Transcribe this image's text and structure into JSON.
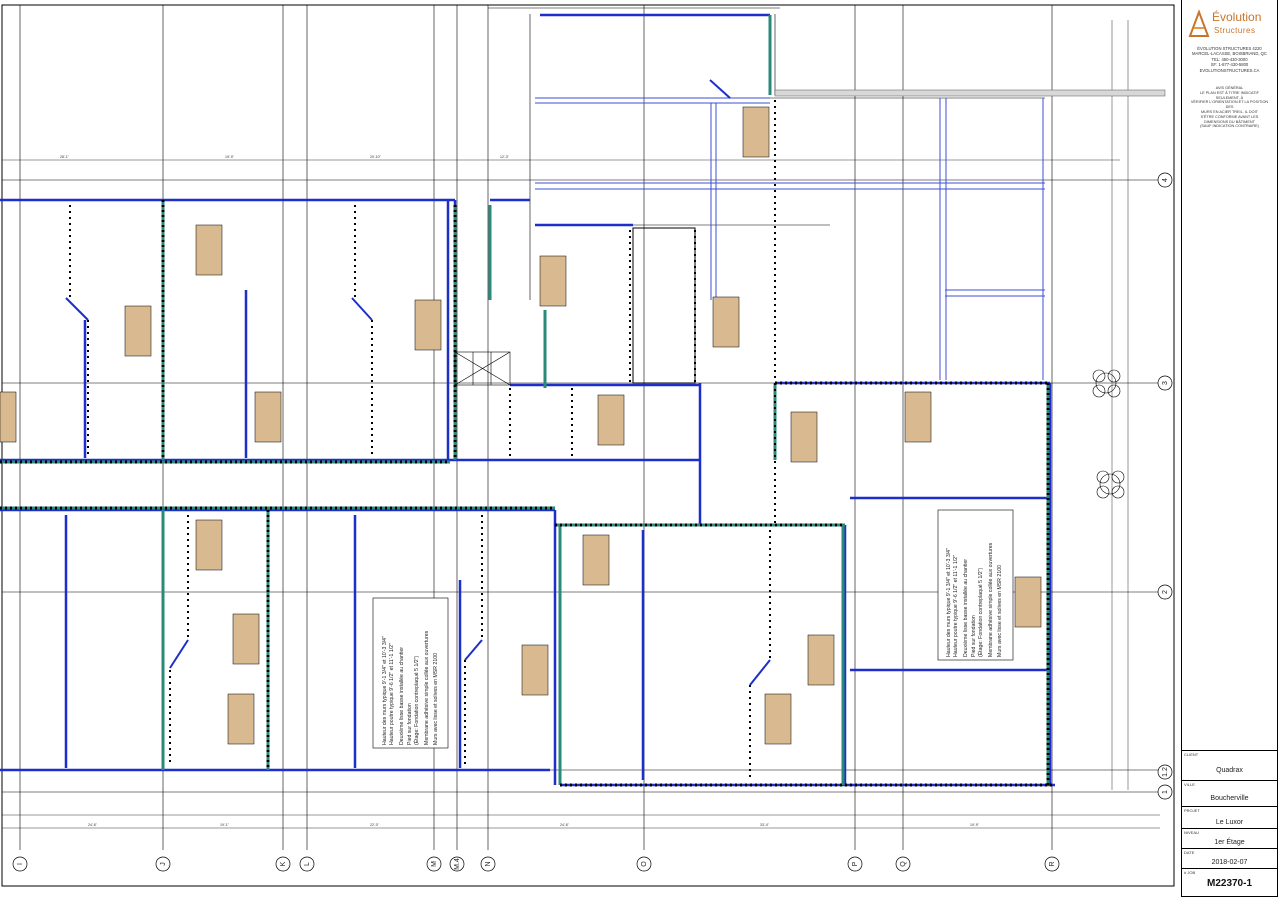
{
  "company": {
    "logo_word_1": "Évolution",
    "logo_word_2": "Structures",
    "lines": [
      "ÉVOLUTION STRUCTURES 4220",
      "MARCEL-LACASSE, BOISBRIAND, QC",
      "TEL: 450-430-3000",
      "SF: 1-877-430-5800",
      "EVOLUTIONSTRUCTURES.CA"
    ]
  },
  "disclaimer": [
    "AVIS GÉNÉRAL",
    "LE PLAN EST À TITRE INDICATIF SEULEMENT, À",
    "VÉRIFIER L'ORIENTATION ET LA POSITION DES",
    "MURS EN ACIER TREIL. IL DOIT",
    "S'ÊTRE CONFORME AVANT LES",
    "DIMENSIONS DU BÂTIMENT",
    "(SAUF INDICATION CONTRAIRE)"
  ],
  "title_block": {
    "client_label": "CLIENT",
    "client": "Quadrax",
    "city_label": "VILLE",
    "city": "Boucherville",
    "project_label": "PROJET",
    "project": "Le Luxor",
    "level_label": "NIVEAU",
    "level": "1er Étage",
    "date_label": "DATE",
    "date": "2018-02-07",
    "job_label": "# JOB",
    "job_number": "M22370-1"
  },
  "wall_notes": [
    {
      "lines": [
        "Hauteur des murs typique 9'-1 3/4\" et 10'-3 3/4\"",
        "Hauteur poutre typique 9'-6 1/2\" et 11'-1 1/2\"",
        "Deuxième lisse basse installée au chantier",
        "Pied sur fondation",
        "(Étage: Fondation contreplaqué 5 1/2\")",
        "Membrane adhésive simple collée aux ouvertures",
        "Murs avec lisse et solives en MSR 2100"
      ]
    },
    {
      "lines": [
        "Hauteur des murs typique 9'-1 3/4\" et 10'-3 3/4\"",
        "Hauteur poutre typique 9'-6 1/2\" et 11'-1 1/2\"",
        "Deuxième lisse basse installée au chantier",
        "Pied sur fondation",
        "(Étage: Fondation contreplaqué 5 1/2\")",
        "Membrane adhésive simple collée aux ouvertures",
        "Murs avec lisse et solives en MSR 2100"
      ]
    }
  ],
  "grid_lines_bottom": [
    "I",
    "J",
    "K",
    "L",
    "M",
    "M.4",
    "N",
    "O",
    "P",
    "Q",
    "R"
  ],
  "grid_lines_right": [
    "4",
    "3",
    "2",
    "1.2",
    "1"
  ],
  "colors": {
    "wall_primary": "#1e2fc9",
    "wall_hatch": "#2a8a7a",
    "label_box": "#d9b98f",
    "logo": "#c8752a",
    "grid": "#000000"
  }
}
